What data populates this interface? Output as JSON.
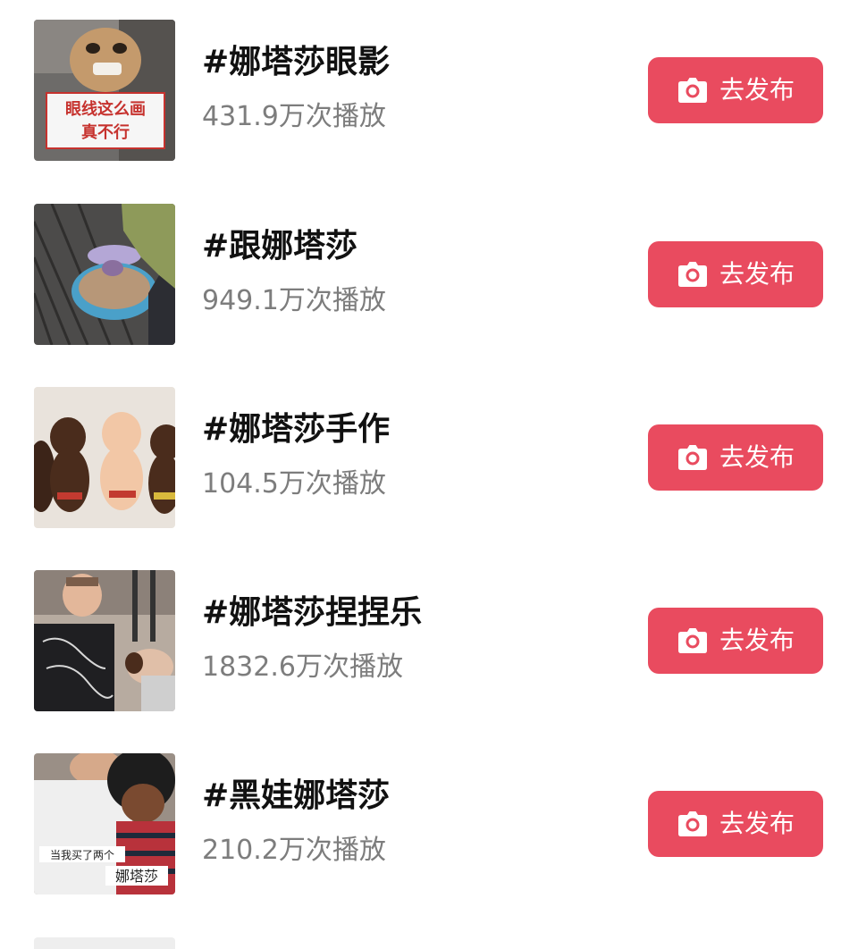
{
  "topics": [
    {
      "title": "#娜塔莎眼影",
      "plays": "431.9万次播放",
      "button_label": "去发布",
      "thumb_caption_line1": "眼线这么画",
      "thumb_caption_line2": "真不行",
      "thumb_icon": "thumbnail-image"
    },
    {
      "title": "#跟娜塔莎",
      "plays": "949.1万次播放",
      "button_label": "去发布",
      "thumb_icon": "thumbnail-image"
    },
    {
      "title": "#娜塔莎手作",
      "plays": "104.5万次播放",
      "button_label": "去发布",
      "thumb_icon": "thumbnail-image"
    },
    {
      "title": "#娜塔莎捏捏乐",
      "plays": "1832.6万次播放",
      "button_label": "去发布",
      "thumb_icon": "thumbnail-image"
    },
    {
      "title": "#黑娃娜塔莎",
      "plays": "210.2万次播放",
      "button_label": "去发布",
      "thumb_caption_line1": "当我买了两个",
      "thumb_caption_line2": "娜塔莎",
      "thumb_icon": "thumbnail-image"
    }
  ],
  "colors": {
    "button": "#e94b5f",
    "title": "#111111",
    "plays": "#7d7d7d",
    "background": "#ffffff"
  },
  "icons": {
    "button_icon": "camera-icon"
  }
}
